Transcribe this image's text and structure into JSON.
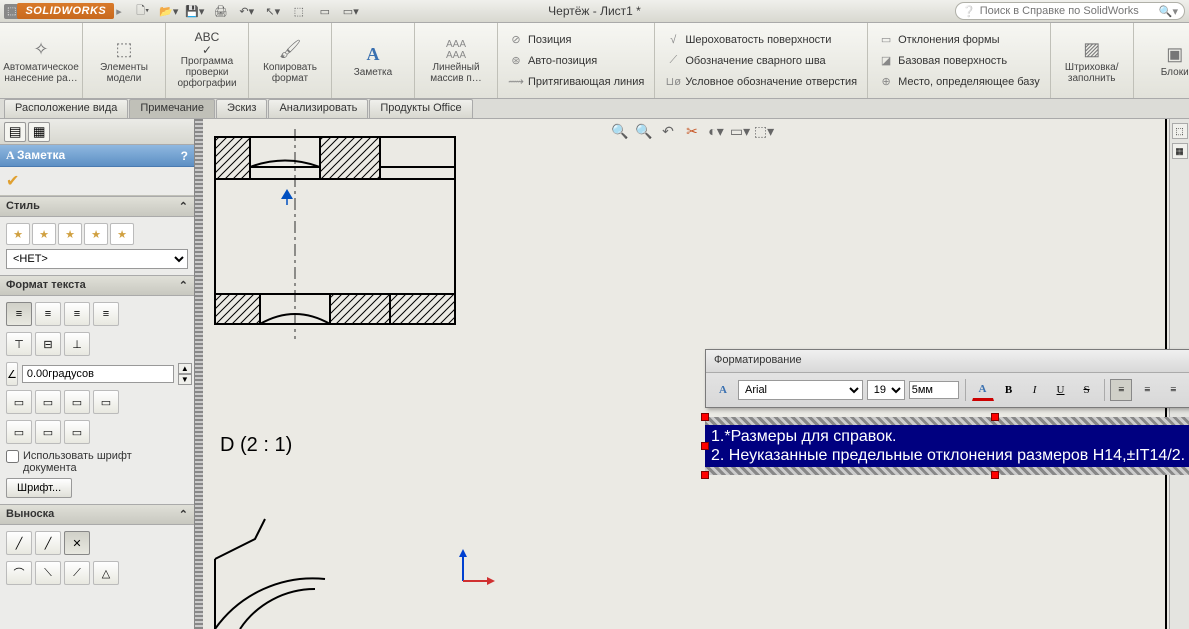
{
  "title_bar": {
    "app_name": "SOLIDWORKS",
    "document_title": "Чертёж - Лист1 *",
    "search_placeholder": "Поиск в Справке по SolidWorks"
  },
  "ribbon": {
    "auto_dimension": "Автоматическое нанесение ра…",
    "model_elements": "Элементы модели",
    "spell_check": "Программа проверки орфографии",
    "copy_format": "Копировать формат",
    "note": "Заметка",
    "linear_pattern": "Линейный массив п…",
    "col1": {
      "pos": "Позиция",
      "auto_pos": "Авто-позиция",
      "magnet_line": "Притягивающая линия"
    },
    "col2": {
      "surface_finish": "Шероховатость поверхности",
      "weld_symbol": "Обозначение сварного шва",
      "hole_callout": "Условное обозначение отверстия"
    },
    "col3": {
      "geom_tol": "Отклонения формы",
      "datum_feature": "Базовая поверхность",
      "datum_target": "Место, определяющее базу"
    },
    "area_hatch": "Штриховка/заполнить",
    "blocks": "Блоки"
  },
  "tabs": {
    "view_layout": "Расположение вида",
    "annotation": "Примечание",
    "sketch": "Эскиз",
    "evaluate": "Анализировать",
    "office": "Продукты Office"
  },
  "panel": {
    "title": "Заметка",
    "sections": {
      "style": "Стиль",
      "text_format": "Формат текста",
      "leader": "Выноска"
    },
    "style_dropdown": "<НЕТ>",
    "angle_value": "0.00градусов",
    "use_doc_font": "Использовать шрифт документа",
    "font_button": "Шрифт..."
  },
  "canvas": {
    "scale_label": "D  (2 : 1)"
  },
  "format_window": {
    "title": "Форматирование",
    "font_name": "Arial",
    "font_size": "19",
    "font_mm": "5мм"
  },
  "note_text": {
    "line1": "1.*Размеры для справок.",
    "line2": "2. Неуказанные предельные отклонения размеров H14,±IT14/2."
  }
}
